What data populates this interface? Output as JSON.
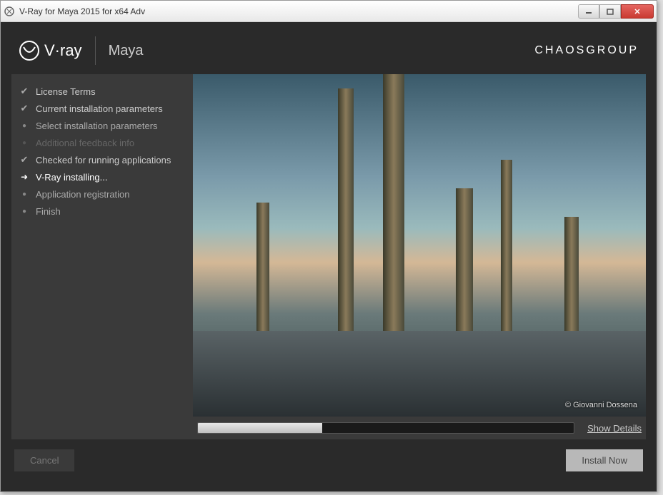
{
  "titlebar": {
    "title": "V-Ray for Maya 2015 for x64 Adv"
  },
  "header": {
    "vray_label": "V·ray",
    "maya_label": "Maya",
    "chaos_label": "CHAOSGROUP"
  },
  "sidebar": {
    "steps": [
      {
        "label": "License Terms",
        "state": "completed"
      },
      {
        "label": "Current installation parameters",
        "state": "completed"
      },
      {
        "label": "Select installation parameters",
        "state": "pending"
      },
      {
        "label": "Additional feedback info",
        "state": "disabled"
      },
      {
        "label": "Checked for running applications",
        "state": "completed"
      },
      {
        "label": "V-Ray installing...",
        "state": "active"
      },
      {
        "label": "Application registration",
        "state": "pending"
      },
      {
        "label": "Finish",
        "state": "pending"
      }
    ]
  },
  "preview": {
    "credit": "© Giovanni Dossena"
  },
  "progress": {
    "percent": 33,
    "show_details_label": "Show Details"
  },
  "footer": {
    "cancel_label": "Cancel",
    "install_label": "Install Now"
  }
}
